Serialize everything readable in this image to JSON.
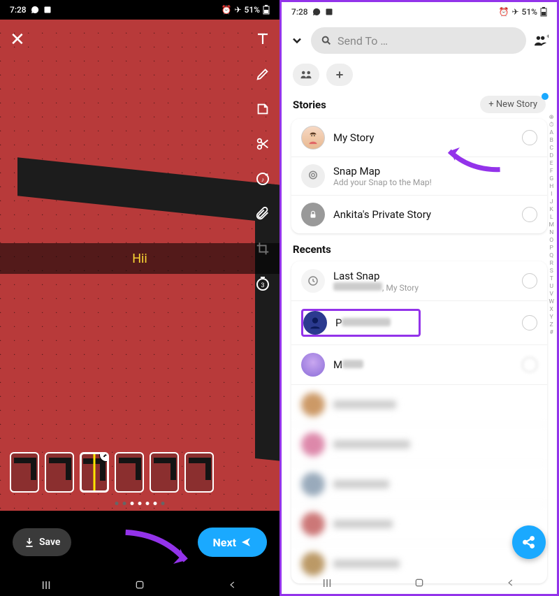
{
  "status": {
    "time": "7:28",
    "battery": "51%"
  },
  "editor": {
    "caption": "Hii",
    "save_label": "Save",
    "next_label": "Next"
  },
  "sendto": {
    "search_placeholder": "Send To …",
    "stories_label": "Stories",
    "new_story_label": "+ New Story",
    "rows": {
      "mystory": "My Story",
      "snapmap_title": "Snap Map",
      "snapmap_sub": "Add your Snap to the Map!",
      "private": "Ankita's Private Story"
    },
    "recents_label": "Recents",
    "recents": {
      "lastsnap_title": "Last Snap",
      "lastsnap_sub": ", My Story",
      "p_initial": "P",
      "m_initial": "M"
    },
    "alpha_index": [
      "⊕",
      "⏱",
      "A",
      "B",
      "C",
      "D",
      "E",
      "F",
      "G",
      "H",
      "I",
      "J",
      "K",
      "L",
      "M",
      "N",
      "O",
      "P",
      "Q",
      "R",
      "S",
      "T",
      "U",
      "V",
      "W",
      "X",
      "Y",
      "Z",
      "#"
    ]
  }
}
